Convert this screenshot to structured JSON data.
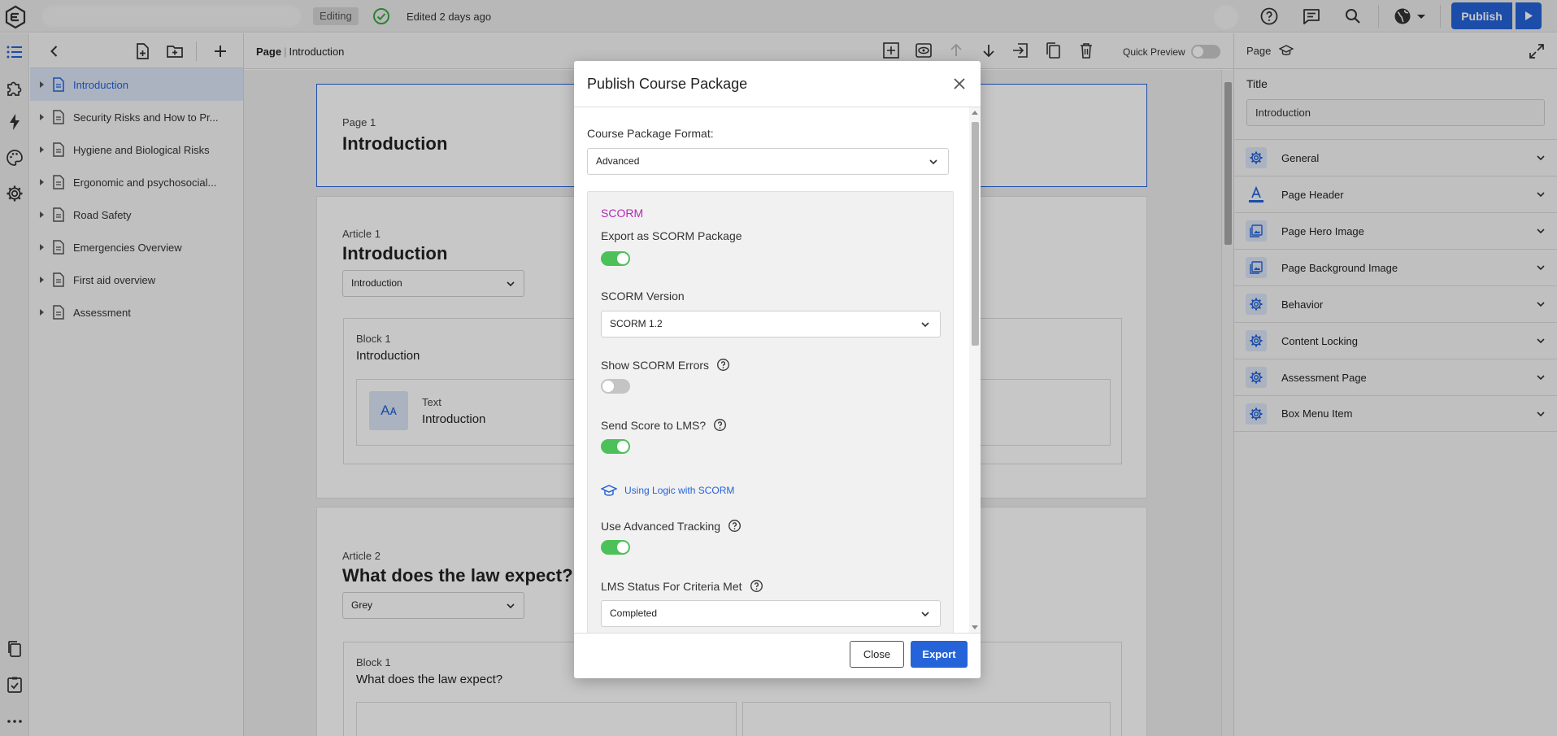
{
  "topbar": {
    "editing_badge": "Editing",
    "saved_status": "Edited 2 days ago",
    "publish_label": "Publish"
  },
  "tree": {
    "items": [
      {
        "label": "Introduction",
        "selected": true
      },
      {
        "label": "Security Risks and How to Pr..."
      },
      {
        "label": "Hygiene and Biological Risks"
      },
      {
        "label": "Ergonomic and psychosocial..."
      },
      {
        "label": "Road Safety"
      },
      {
        "label": "Emergencies Overview"
      },
      {
        "label": "First aid overview"
      },
      {
        "label": "Assessment"
      }
    ]
  },
  "editor": {
    "breadcrumb": {
      "root": "Page",
      "current": "Introduction"
    },
    "quick_preview": "Quick Preview",
    "page": {
      "label": "Page 1",
      "title": "Introduction"
    },
    "article1": {
      "label": "Article 1",
      "title": "Introduction",
      "select_value": "Introduction"
    },
    "block1": {
      "label": "Block 1",
      "title": "Introduction",
      "component_type": "Text",
      "component_title": "Introduction",
      "component_icon_text": "Aᴀ"
    },
    "article2": {
      "label": "Article 2",
      "title": "What does the law expect?",
      "select_value": "Grey"
    },
    "block2": {
      "label": "Block 1",
      "title": "What does the law expect?"
    }
  },
  "right_panel": {
    "header": "Page",
    "title_label": "Title",
    "title_value": "Introduction",
    "sections": [
      {
        "label": "General",
        "icon": "gear-icon"
      },
      {
        "label": "Page Header",
        "icon": "text-color-icon"
      },
      {
        "label": "Page Hero Image",
        "icon": "image-icon"
      },
      {
        "label": "Page Background Image",
        "icon": "image-icon"
      },
      {
        "label": "Behavior",
        "icon": "gear-icon"
      },
      {
        "label": "Content Locking",
        "icon": "gear-icon"
      },
      {
        "label": "Assessment Page",
        "icon": "gear-icon"
      },
      {
        "label": "Box Menu Item",
        "icon": "gear-icon"
      }
    ]
  },
  "modal": {
    "title": "Publish Course Package",
    "format_label": "Course Package Format:",
    "format_value": "Advanced",
    "scorm_heading": "SCORM",
    "export_scorm_label": "Export as SCORM Package",
    "export_scorm_on": true,
    "scorm_version_label": "SCORM Version",
    "scorm_version_value": "SCORM 1.2",
    "show_errors_label": "Show SCORM Errors",
    "show_errors_on": false,
    "send_score_label": "Send Score to LMS?",
    "send_score_on": true,
    "logic_link": "Using Logic with SCORM",
    "adv_tracking_label": "Use Advanced Tracking",
    "adv_tracking_on": true,
    "lms_status_label": "LMS Status For Criteria Met",
    "lms_status_value": "Completed",
    "close_label": "Close",
    "export_label": "Export"
  },
  "colors": {
    "accent": "#2563d9",
    "toggle_on": "#4cc15a",
    "scorm_heading": "#b52ab5"
  }
}
